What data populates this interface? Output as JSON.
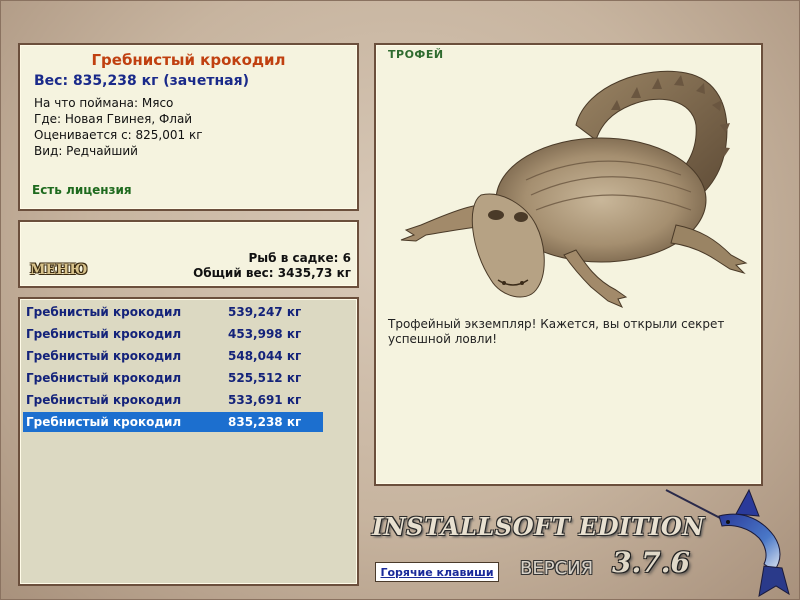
{
  "info": {
    "title": "Гребнистый крокодил",
    "weight": "Вес: 835,238 кг (зачетная)",
    "bait": "На что поймана: Мясо",
    "location": "Где: Новая Гвинея, Флай",
    "valued_from": "Оценивается с: 825,001 кг",
    "kind": "Вид: Редчайший",
    "license": "Есть лицензия"
  },
  "summary": {
    "menu_label": "МЕНЮ",
    "fish_count": "Рыб в садке: 6",
    "total_weight": "Общий вес: 3435,73 кг"
  },
  "catch_list": [
    {
      "name": "Гребнистый крокодил",
      "weight": "539,247 кг",
      "selected": false
    },
    {
      "name": "Гребнистый крокодил",
      "weight": "453,998 кг",
      "selected": false
    },
    {
      "name": "Гребнистый крокодил",
      "weight": "548,044 кг",
      "selected": false
    },
    {
      "name": "Гребнистый крокодил",
      "weight": "525,512 кг",
      "selected": false
    },
    {
      "name": "Гребнистый крокодил",
      "weight": "533,691 кг",
      "selected": false
    },
    {
      "name": "Гребнистый крокодил",
      "weight": "835,238 кг",
      "selected": true
    }
  ],
  "trophy": {
    "header": "ТРОФЕЙ",
    "text": "Трофейный экземпляр! Кажется, вы открыли секрет успешной ловли!"
  },
  "footer": {
    "brand": "INSTALLSOFT EDITION",
    "version_label": "ВЕРСИЯ",
    "version_number": "3.7.6",
    "hotkeys_label": "Горячие клавиши"
  },
  "colors": {
    "selection": "#1c6fcf",
    "title_red": "#c04010",
    "weight_blue": "#1a2a8a",
    "license_green": "#1e6a1e",
    "panel_bg": "#f5f3df"
  }
}
